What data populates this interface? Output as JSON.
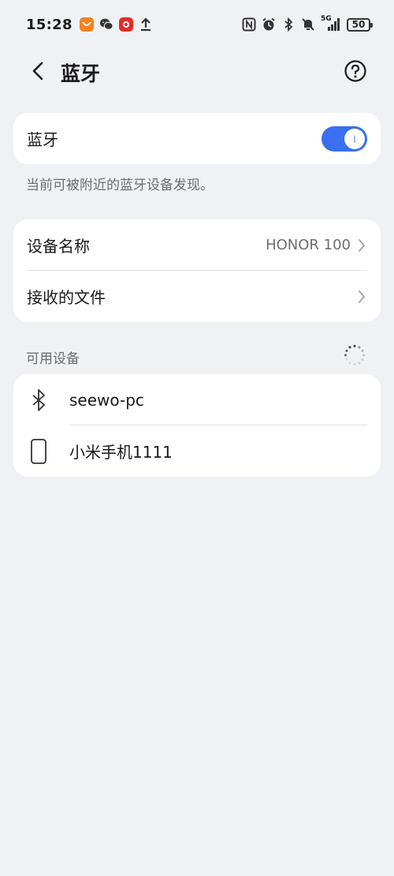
{
  "status_bar": {
    "time": "15:28",
    "network": "5G",
    "battery": "50",
    "app_icons": [
      "taobao-icon",
      "wechat-icon",
      "pinduoduo-icon",
      "upload-icon"
    ],
    "system_icons": [
      "nfc-icon",
      "alarm-icon",
      "bluetooth-icon",
      "mute-icon",
      "signal-icon"
    ]
  },
  "header": {
    "title": "蓝牙",
    "back_icon": "chevron-left-icon",
    "help_icon": "help-circle-icon"
  },
  "bluetooth_card": {
    "label": "蓝牙",
    "toggle_on": true,
    "accent_color": "#3a6ff2"
  },
  "hint": "当前可被附近的蓝牙设备发现。",
  "device_card": {
    "name_label": "设备名称",
    "name_value": "HONOR 100",
    "received_files_label": "接收的文件"
  },
  "available_section": {
    "title": "可用设备",
    "loading_icon": "spinner-icon",
    "devices": [
      {
        "name": "seewo-pc",
        "icon": "bluetooth-icon"
      },
      {
        "name": "小米手机1111",
        "icon": "phone-icon"
      }
    ]
  }
}
